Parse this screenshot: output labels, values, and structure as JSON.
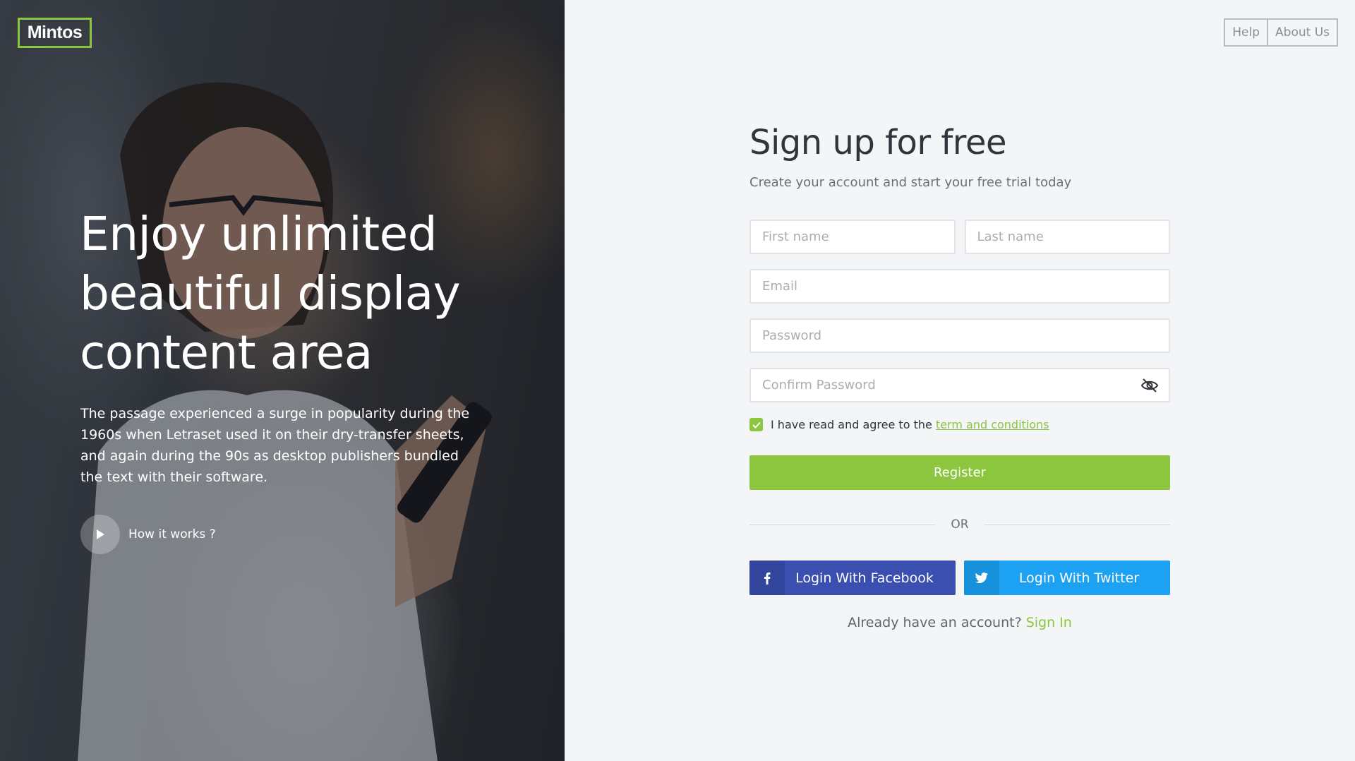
{
  "brand": {
    "logo_text": "Mintos",
    "accent_color": "#8cc63f"
  },
  "hero": {
    "title": "Enjoy unlimited beautiful display content area",
    "text": "The passage experienced a surge in popularity during the 1960s when Letraset used it on their dry-transfer sheets, and again during the 90s as desktop publishers bundled the text with their software.",
    "how_it_works_label": "How it works ?",
    "play_icon": "play-icon"
  },
  "nav": {
    "help_label": "Help",
    "about_label": "About Us"
  },
  "form": {
    "title": "Sign up for free",
    "subtitle": "Create your account and start your free trial today",
    "first_name_placeholder": "First name",
    "last_name_placeholder": "Last name",
    "email_placeholder": "Email",
    "password_placeholder": "Password",
    "confirm_password_placeholder": "Confirm Password",
    "agree_text": "I have read and agree to the",
    "terms_link": "term and conditions",
    "agree_checked": true,
    "register_label": "Register",
    "or_label": "OR",
    "facebook_label": "Login With Facebook",
    "twitter_label": "Login With Twitter",
    "already_text": "Already have an account?",
    "signin_link": "Sign In"
  },
  "colors": {
    "facebook": "#3b4fb1",
    "twitter": "#1da1f2",
    "background": "#f4f5f7"
  }
}
